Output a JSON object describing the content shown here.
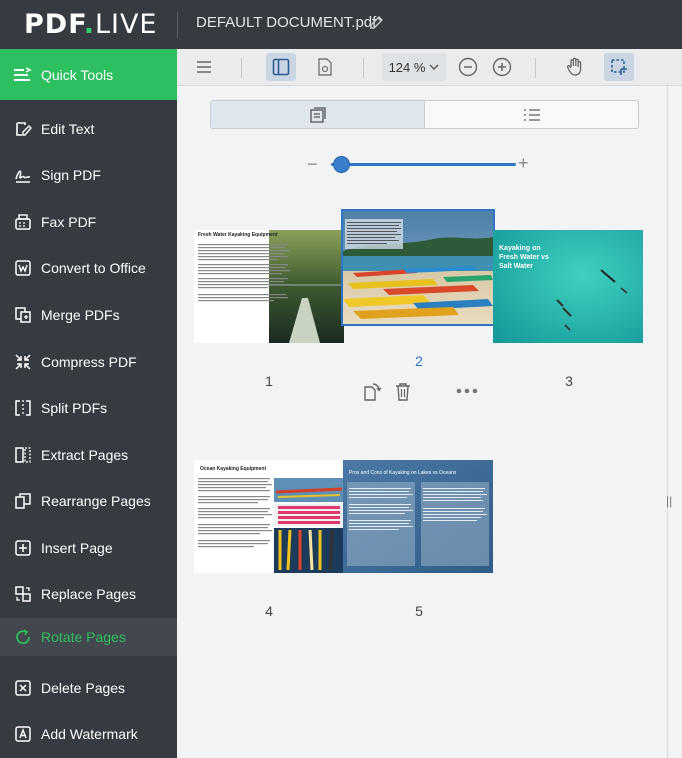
{
  "app": {
    "logo_main": "PDF",
    "logo_dot": ".",
    "logo_live": "LIVE",
    "document_title": "DEFAULT DOCUMENT.pdf"
  },
  "sidebar": {
    "items": [
      {
        "label": "Quick Tools",
        "icon": "quick-tools-icon"
      },
      {
        "label": "Edit Text",
        "icon": "edit-text-icon"
      },
      {
        "label": "Sign PDF",
        "icon": "sign-icon"
      },
      {
        "label": "Fax PDF",
        "icon": "fax-icon"
      },
      {
        "label": "Convert to Office",
        "icon": "word-icon"
      },
      {
        "label": "Merge PDFs",
        "icon": "merge-icon"
      },
      {
        "label": "Compress PDF",
        "icon": "compress-icon"
      },
      {
        "label": "Split PDFs",
        "icon": "split-icon"
      },
      {
        "label": "Extract Pages",
        "icon": "extract-icon"
      },
      {
        "label": "Rearrange Pages",
        "icon": "rearrange-icon"
      },
      {
        "label": "Insert Page",
        "icon": "insert-icon"
      },
      {
        "label": "Replace Pages",
        "icon": "replace-icon"
      },
      {
        "label": "Rotate Pages",
        "icon": "rotate-icon"
      },
      {
        "label": "Delete Pages",
        "icon": "delete-icon"
      },
      {
        "label": "Add Watermark",
        "icon": "watermark-icon"
      }
    ],
    "active": "Rotate Pages"
  },
  "toolbar": {
    "zoom_label": "124 %"
  },
  "thumbnails": {
    "pages": [
      {
        "number": "1",
        "title": "Fresh Water Kayaking Equipment"
      },
      {
        "number": "2",
        "title": ""
      },
      {
        "number": "3",
        "title": "Kayaking on Fresh Water vs Salt Water"
      },
      {
        "number": "4",
        "title": "Ocean Kayaking Equipment"
      },
      {
        "number": "5",
        "title": "Pros and Cons of Kayaking on Lakes vs Oceans"
      }
    ],
    "selected": "2"
  },
  "colors": {
    "brand_green": "#2ec060",
    "sidebar_bg": "#353b40",
    "accent_blue": "#2e75c4"
  }
}
